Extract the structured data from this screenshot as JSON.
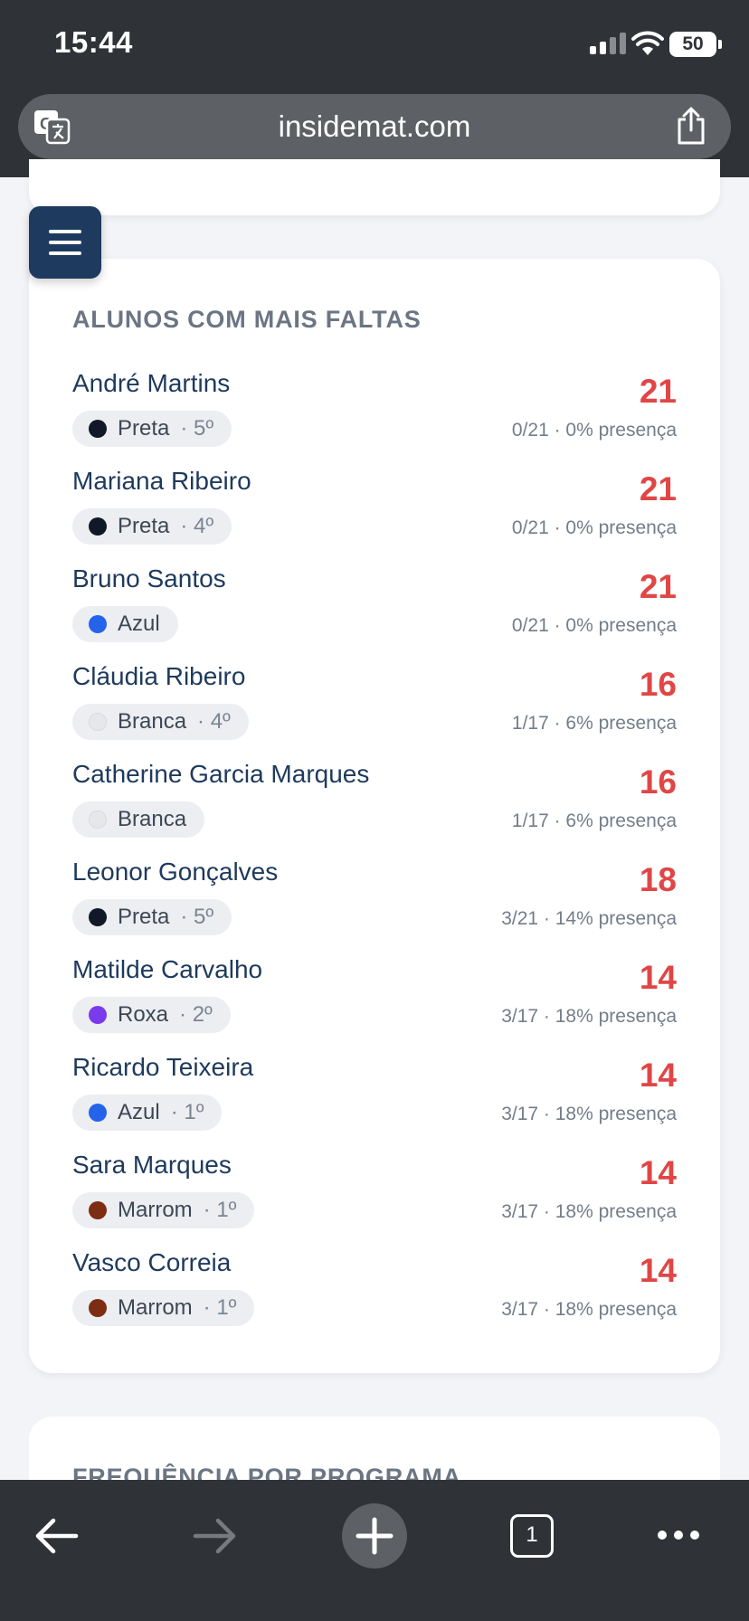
{
  "status_bar": {
    "time": "15:44",
    "battery": "50"
  },
  "browser": {
    "url": "insidemat.com",
    "tab_count": "1"
  },
  "card": {
    "title": "ALUNOS COM MAIS FALTAS",
    "students": [
      {
        "name": "André Martins",
        "belt": "Preta",
        "belt_color": "#111827",
        "degree": "· 5º",
        "absences": "21",
        "presence": "0/21 · 0% presença"
      },
      {
        "name": "Mariana Ribeiro",
        "belt": "Preta",
        "belt_color": "#111827",
        "degree": "· 4º",
        "absences": "21",
        "presence": "0/21 · 0% presença"
      },
      {
        "name": "Bruno Santos",
        "belt": "Azul",
        "belt_color": "#2563eb",
        "degree": "",
        "absences": "21",
        "presence": "0/21 · 0% presença"
      },
      {
        "name": "Cláudia Ribeiro",
        "belt": "Branca",
        "belt_color": "#e5e7eb",
        "degree": "· 4º",
        "absences": "16",
        "presence": "1/17 · 6% presença"
      },
      {
        "name": "Catherine Garcia Marques",
        "belt": "Branca",
        "belt_color": "#e5e7eb",
        "degree": "",
        "absences": "16",
        "presence": "1/17 · 6% presença"
      },
      {
        "name": "Leonor Gonçalves",
        "belt": "Preta",
        "belt_color": "#111827",
        "degree": "· 5º",
        "absences": "18",
        "presence": "3/21 · 14% presença"
      },
      {
        "name": "Matilde Carvalho",
        "belt": "Roxa",
        "belt_color": "#7c3aed",
        "degree": "· 2º",
        "absences": "14",
        "presence": "3/17 · 18% presença"
      },
      {
        "name": "Ricardo Teixeira",
        "belt": "Azul",
        "belt_color": "#2563eb",
        "degree": "· 1º",
        "absences": "14",
        "presence": "3/17 · 18% presença"
      },
      {
        "name": "Sara Marques",
        "belt": "Marrom",
        "belt_color": "#7c2d12",
        "degree": "· 1º",
        "absences": "14",
        "presence": "3/17 · 18% presença"
      },
      {
        "name": "Vasco Correia",
        "belt": "Marrom",
        "belt_color": "#7c2d12",
        "degree": "· 1º",
        "absences": "14",
        "presence": "3/17 · 18% presença"
      }
    ]
  },
  "next_card": {
    "title": "FREQUÊNCIA POR PROGRAMA"
  },
  "colors": {
    "accent": "#e04646",
    "menu_button": "#1f3a5f",
    "name_text": "#1e3a5c"
  }
}
